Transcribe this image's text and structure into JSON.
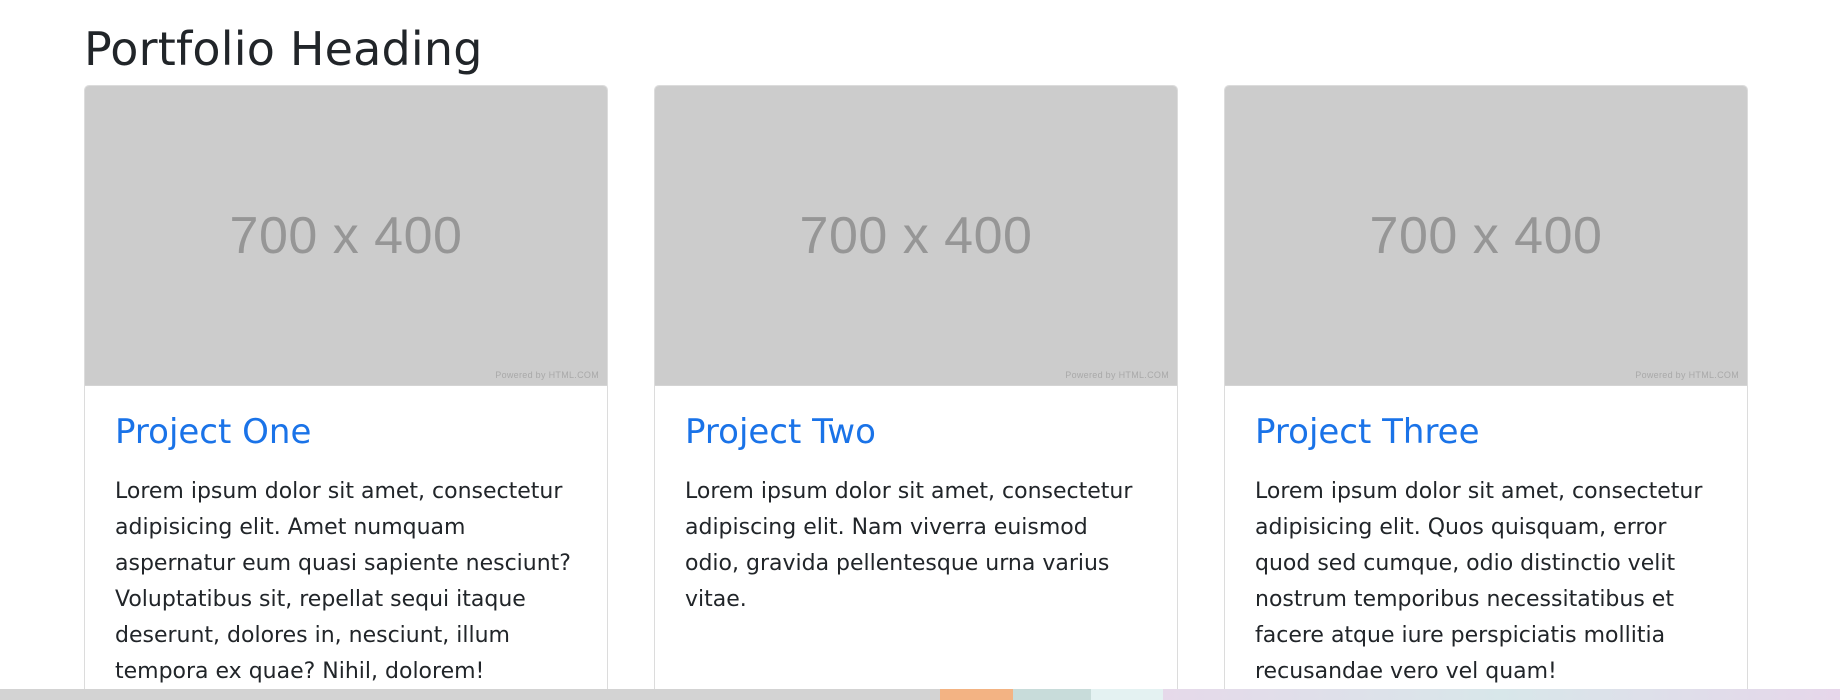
{
  "page": {
    "title": "Portfolio Heading"
  },
  "cards": [
    {
      "image_label": "700 x 400",
      "image_caption": "Powered by HTML.COM",
      "title": "Project One",
      "text": "Lorem ipsum dolor sit amet, consectetur adipisicing elit. Amet numquam aspernatur eum quasi sapiente nesciunt? Voluptatibus sit, repellat sequi itaque deserunt, dolores in, nesciunt, illum tempora ex quae? Nihil, dolorem!"
    },
    {
      "image_label": "700 x 400",
      "image_caption": "Powered by HTML.COM",
      "title": "Project Two",
      "text": "Lorem ipsum dolor sit amet, consectetur adipiscing elit. Nam viverra euismod odio, gravida pellentesque urna varius vitae."
    },
    {
      "image_label": "700 x 400",
      "image_caption": "Powered by HTML.COM",
      "title": "Project Three",
      "text": "Lorem ipsum dolor sit amet, consectetur adipisicing elit. Quos quisquam, error quod sed cumque, odio distinctio velit nostrum temporibus necessitatibus et facere atque iure perspiciatis mollitia recusandae vero vel quam!"
    }
  ],
  "colors": {
    "link": "#1a73e8",
    "heading": "#212529",
    "placeholder_bg": "#cccccc",
    "placeholder_text": "#969696"
  }
}
